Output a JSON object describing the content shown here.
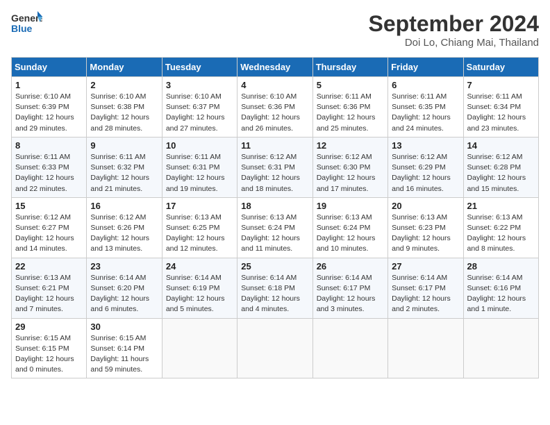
{
  "logo": {
    "text_general": "General",
    "text_blue": "Blue"
  },
  "title": "September 2024",
  "location": "Doi Lo, Chiang Mai, Thailand",
  "days_of_week": [
    "Sunday",
    "Monday",
    "Tuesday",
    "Wednesday",
    "Thursday",
    "Friday",
    "Saturday"
  ],
  "weeks": [
    [
      {
        "day": "1",
        "sunrise": "6:10 AM",
        "sunset": "6:39 PM",
        "daylight": "12 hours and 29 minutes."
      },
      {
        "day": "2",
        "sunrise": "6:10 AM",
        "sunset": "6:38 PM",
        "daylight": "12 hours and 28 minutes."
      },
      {
        "day": "3",
        "sunrise": "6:10 AM",
        "sunset": "6:37 PM",
        "daylight": "12 hours and 27 minutes."
      },
      {
        "day": "4",
        "sunrise": "6:10 AM",
        "sunset": "6:36 PM",
        "daylight": "12 hours and 26 minutes."
      },
      {
        "day": "5",
        "sunrise": "6:11 AM",
        "sunset": "6:36 PM",
        "daylight": "12 hours and 25 minutes."
      },
      {
        "day": "6",
        "sunrise": "6:11 AM",
        "sunset": "6:35 PM",
        "daylight": "12 hours and 24 minutes."
      },
      {
        "day": "7",
        "sunrise": "6:11 AM",
        "sunset": "6:34 PM",
        "daylight": "12 hours and 23 minutes."
      }
    ],
    [
      {
        "day": "8",
        "sunrise": "6:11 AM",
        "sunset": "6:33 PM",
        "daylight": "12 hours and 22 minutes."
      },
      {
        "day": "9",
        "sunrise": "6:11 AM",
        "sunset": "6:32 PM",
        "daylight": "12 hours and 21 minutes."
      },
      {
        "day": "10",
        "sunrise": "6:11 AM",
        "sunset": "6:31 PM",
        "daylight": "12 hours and 19 minutes."
      },
      {
        "day": "11",
        "sunrise": "6:12 AM",
        "sunset": "6:31 PM",
        "daylight": "12 hours and 18 minutes."
      },
      {
        "day": "12",
        "sunrise": "6:12 AM",
        "sunset": "6:30 PM",
        "daylight": "12 hours and 17 minutes."
      },
      {
        "day": "13",
        "sunrise": "6:12 AM",
        "sunset": "6:29 PM",
        "daylight": "12 hours and 16 minutes."
      },
      {
        "day": "14",
        "sunrise": "6:12 AM",
        "sunset": "6:28 PM",
        "daylight": "12 hours and 15 minutes."
      }
    ],
    [
      {
        "day": "15",
        "sunrise": "6:12 AM",
        "sunset": "6:27 PM",
        "daylight": "12 hours and 14 minutes."
      },
      {
        "day": "16",
        "sunrise": "6:12 AM",
        "sunset": "6:26 PM",
        "daylight": "12 hours and 13 minutes."
      },
      {
        "day": "17",
        "sunrise": "6:13 AM",
        "sunset": "6:25 PM",
        "daylight": "12 hours and 12 minutes."
      },
      {
        "day": "18",
        "sunrise": "6:13 AM",
        "sunset": "6:24 PM",
        "daylight": "12 hours and 11 minutes."
      },
      {
        "day": "19",
        "sunrise": "6:13 AM",
        "sunset": "6:24 PM",
        "daylight": "12 hours and 10 minutes."
      },
      {
        "day": "20",
        "sunrise": "6:13 AM",
        "sunset": "6:23 PM",
        "daylight": "12 hours and 9 minutes."
      },
      {
        "day": "21",
        "sunrise": "6:13 AM",
        "sunset": "6:22 PM",
        "daylight": "12 hours and 8 minutes."
      }
    ],
    [
      {
        "day": "22",
        "sunrise": "6:13 AM",
        "sunset": "6:21 PM",
        "daylight": "12 hours and 7 minutes."
      },
      {
        "day": "23",
        "sunrise": "6:14 AM",
        "sunset": "6:20 PM",
        "daylight": "12 hours and 6 minutes."
      },
      {
        "day": "24",
        "sunrise": "6:14 AM",
        "sunset": "6:19 PM",
        "daylight": "12 hours and 5 minutes."
      },
      {
        "day": "25",
        "sunrise": "6:14 AM",
        "sunset": "6:18 PM",
        "daylight": "12 hours and 4 minutes."
      },
      {
        "day": "26",
        "sunrise": "6:14 AM",
        "sunset": "6:17 PM",
        "daylight": "12 hours and 3 minutes."
      },
      {
        "day": "27",
        "sunrise": "6:14 AM",
        "sunset": "6:17 PM",
        "daylight": "12 hours and 2 minutes."
      },
      {
        "day": "28",
        "sunrise": "6:14 AM",
        "sunset": "6:16 PM",
        "daylight": "12 hours and 1 minute."
      }
    ],
    [
      {
        "day": "29",
        "sunrise": "6:15 AM",
        "sunset": "6:15 PM",
        "daylight": "12 hours and 0 minutes."
      },
      {
        "day": "30",
        "sunrise": "6:15 AM",
        "sunset": "6:14 PM",
        "daylight": "11 hours and 59 minutes."
      },
      null,
      null,
      null,
      null,
      null
    ]
  ],
  "labels": {
    "sunrise_prefix": "Sunrise: ",
    "sunset_prefix": "Sunset: ",
    "daylight_prefix": "Daylight: "
  }
}
